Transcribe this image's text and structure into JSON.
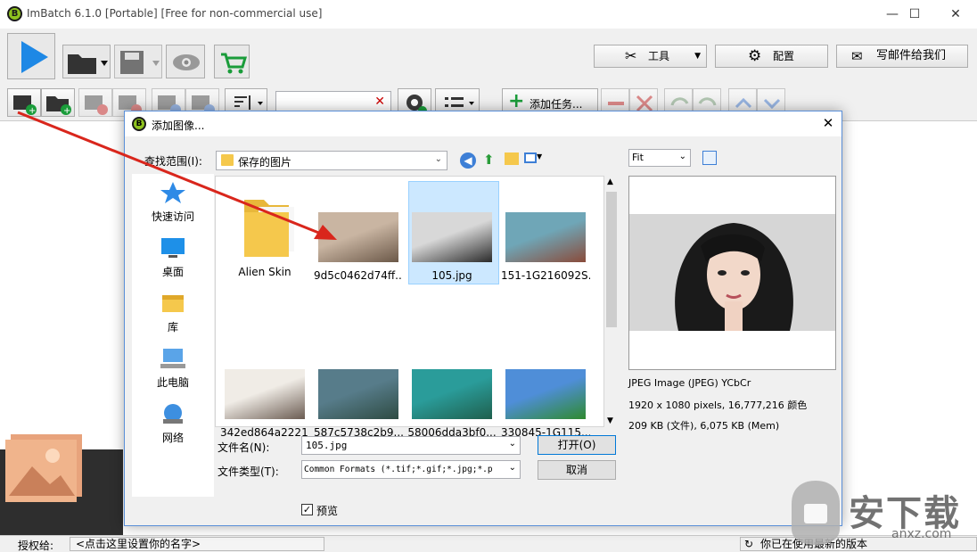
{
  "app": {
    "title": "ImBatch 6.1.0 [Portable] [Free for non-commercial use]",
    "logo_letter": "B",
    "window_controls": [
      "—",
      "☐",
      "✕"
    ]
  },
  "toolbar1": {
    "tools_label": "工具",
    "config_label": "配置",
    "mail_label": "写邮件给我们"
  },
  "toolbar2": {
    "add_task_label": "添加任务...",
    "search_placeholder": ""
  },
  "status": {
    "license_label": "授权给:",
    "license_value": "<点击这里设置你的名字>",
    "version_text": "你已在使用最新的版本"
  },
  "dialog": {
    "title": "添加图像...",
    "logo_letter": "B",
    "lookin_label": "查找范围(I):",
    "lookin_value": "保存的图片",
    "places": [
      {
        "label": "快速访问",
        "icon": "star-icon"
      },
      {
        "label": "桌面",
        "icon": "desktop-icon"
      },
      {
        "label": "库",
        "icon": "library-icon"
      },
      {
        "label": "此电脑",
        "icon": "computer-icon"
      },
      {
        "label": "网络",
        "icon": "network-icon"
      }
    ],
    "files": [
      {
        "name": "Alien Skin",
        "kind": "folder"
      },
      {
        "name": "9d5c0462d74ff...",
        "kind": "image",
        "colors": [
          "#c9b5a2",
          "#6b5848"
        ]
      },
      {
        "name": "105.jpg",
        "kind": "image",
        "colors": [
          "#d8d8d8",
          "#2a2a2a"
        ],
        "selected": true
      },
      {
        "name": "151-1G216092S...",
        "kind": "image",
        "colors": [
          "#6fa6b7",
          "#8a4b3a"
        ]
      },
      {
        "name": "342ed864a2221...",
        "kind": "image",
        "colors": [
          "#f0ece6",
          "#6b5c52"
        ]
      },
      {
        "name": "587c5738c2b9...",
        "kind": "image",
        "colors": [
          "#577c8a",
          "#2e4b42"
        ]
      },
      {
        "name": "58006dda3bf0...",
        "kind": "image",
        "colors": [
          "#2a9c9a",
          "#1f5f4d"
        ]
      },
      {
        "name": "330845-1G115...",
        "kind": "image",
        "colors": [
          "#4f8ed8",
          "#2f8a2f"
        ]
      }
    ],
    "filename_label": "文件名(N):",
    "filename_value": "105.jpg",
    "filetype_label": "文件类型(T):",
    "filetype_value": "Common Formats (*.tif;*.gif;*.jpg;*.p",
    "open_button": "打开(O)",
    "cancel_button": "取消",
    "preview_checkbox": "预览",
    "preview_checked": true,
    "zoom_value": "Fit",
    "info_line1": "JPEG Image (JPEG) YCbCr",
    "info_line2": "1920 x 1080 pixels, 16,777,216 颜色",
    "info_line3": "209 KB (文件), 6,075 KB (Mem)"
  },
  "watermark": {
    "text": "安下载",
    "sub": "anxz.com"
  },
  "colors": {
    "accent_blue": "#1e88e5",
    "arrow_red": "#d9261c",
    "selection": "#cce8ff"
  }
}
